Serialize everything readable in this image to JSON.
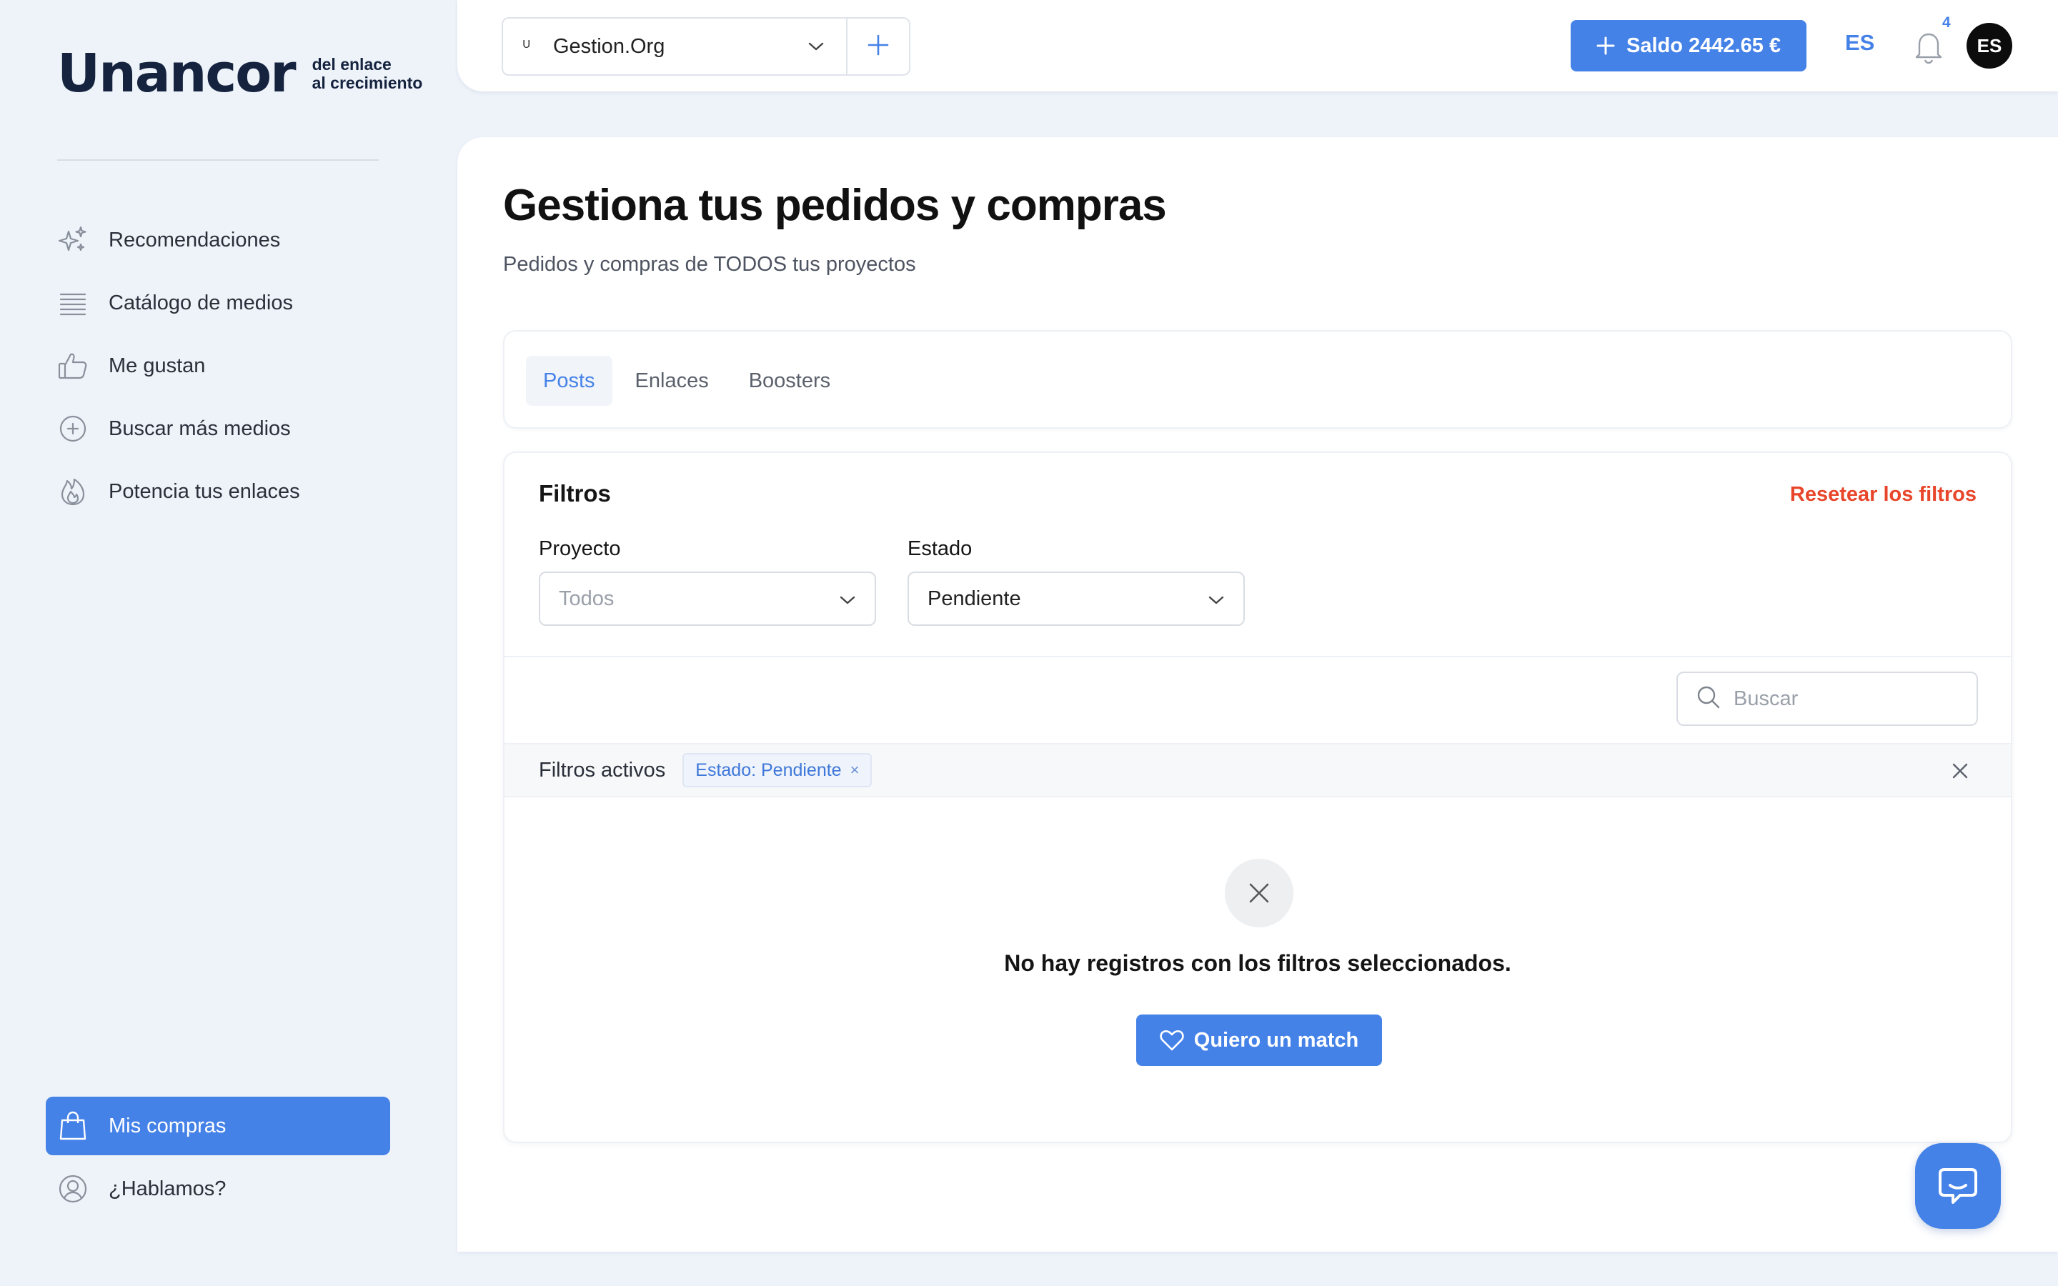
{
  "brand": {
    "logo_text": "Unancor",
    "tagline_1": "del enlace",
    "tagline_2": "al crecimiento"
  },
  "sidebar": {
    "items": [
      {
        "label": "Recomendaciones",
        "icon": "sparkles-icon"
      },
      {
        "label": "Catálogo de medios",
        "icon": "list-icon"
      },
      {
        "label": "Me gustan",
        "icon": "thumbs-up-icon"
      },
      {
        "label": "Buscar más medios",
        "icon": "plus-circle-icon"
      },
      {
        "label": "Potencia tus enlaces",
        "icon": "flame-icon"
      }
    ],
    "bottom_items": [
      {
        "label": "Mis compras",
        "icon": "shopping-bag-icon",
        "active": true
      },
      {
        "label": "¿Hablamos?",
        "icon": "user-circle-icon",
        "active": false
      }
    ]
  },
  "topbar": {
    "project": "Gestion.Org",
    "project_favicon": "ᵁ",
    "saldo_label": "Saldo 2442.65 €",
    "language": "ES",
    "notification_count": "4",
    "avatar_initials": "ES"
  },
  "page": {
    "title": "Gestiona tus pedidos y compras",
    "subtitle": "Pedidos y compras de TODOS tus proyectos"
  },
  "tabs": [
    {
      "label": "Posts",
      "active": true
    },
    {
      "label": "Enlaces",
      "active": false
    },
    {
      "label": "Boosters",
      "active": false
    }
  ],
  "filters": {
    "title": "Filtros",
    "reset_label": "Resetear los filtros",
    "project_label": "Proyecto",
    "project_placeholder": "Todos",
    "status_label": "Estado",
    "status_value": "Pendiente",
    "search_placeholder": "Buscar",
    "active_label": "Filtros activos",
    "active_chip": "Estado: Pendiente"
  },
  "empty_state": {
    "message": "No hay registros con los filtros seleccionados.",
    "button_label": "Quiero un match"
  },
  "colors": {
    "accent": "#4582e8",
    "danger": "#e8462a",
    "background": "#eef3fa",
    "brand_dark": "#15233f"
  }
}
